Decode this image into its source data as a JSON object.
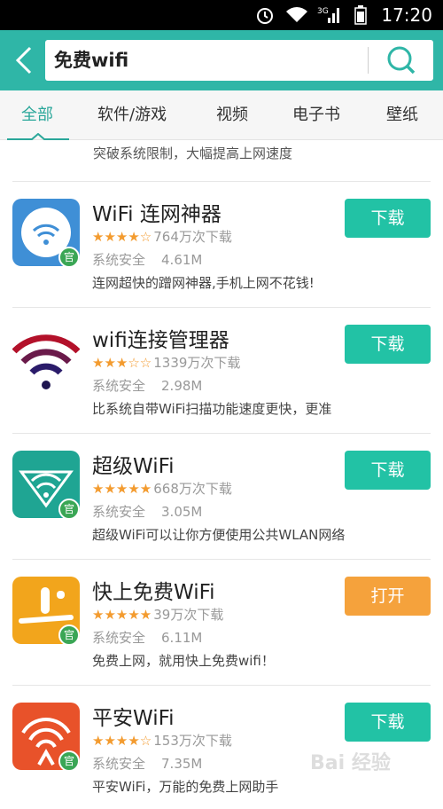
{
  "status_bar": {
    "time": "17:20",
    "signal_label": "3G"
  },
  "search": {
    "query": "免费wifi"
  },
  "tabs": [
    {
      "label": "全部",
      "active": true
    },
    {
      "label": "软件/游戏"
    },
    {
      "label": "视频"
    },
    {
      "label": "电子书"
    },
    {
      "label": "壁纸"
    }
  ],
  "prev_desc": "突破系统限制，大幅提高上网速度",
  "apps": [
    {
      "name": "WiFi 连网神器",
      "stars": "★★★★☆",
      "downloads": "764万次下载",
      "safety": "系统安全",
      "size": "4.61M",
      "desc": "连网超快的蹭网神器,手机上网不花钱!",
      "button": "下载",
      "official": "官",
      "icon": "wifi-shield-blue-icon"
    },
    {
      "name": "wifi连接管理器",
      "stars": "★★★☆☆",
      "downloads": "1339万次下载",
      "safety": "系统安全",
      "size": "2.98M",
      "desc": "比系统自带WiFi扫描功能速度更快，更准",
      "button": "下载",
      "official": "",
      "icon": "wifi-arcs-purple-red-icon"
    },
    {
      "name": "超级WiFi",
      "stars": "★★★★★",
      "downloads": "668万次下载",
      "safety": "系统安全",
      "size": "3.05M",
      "desc": "超级WiFi可以让你方便使用公共WLAN网络",
      "button": "下载",
      "official": "官",
      "icon": "wifi-diamond-teal-icon"
    },
    {
      "name": "快上免费WiFi",
      "stars": "★★★★★",
      "downloads": "39万次下载",
      "safety": "系统安全",
      "size": "6.11M",
      "desc": "免费上网，就用快上免费wifi！",
      "button": "打开",
      "official": "官",
      "icon": "smiley-orange-icon"
    },
    {
      "name": "平安WiFi",
      "stars": "★★★★☆",
      "downloads": "153万次下载",
      "safety": "系统安全",
      "size": "7.35M",
      "desc": "平安WiFi，万能的免费上网助手",
      "button": "下载",
      "official": "官",
      "icon": "wifi-red-icon"
    }
  ],
  "watermark": "Bai 经验",
  "colors": {
    "accent": "#2fb6a7",
    "download": "#22c2a5",
    "open": "#f5a23c",
    "stars": "#f39b2f"
  }
}
